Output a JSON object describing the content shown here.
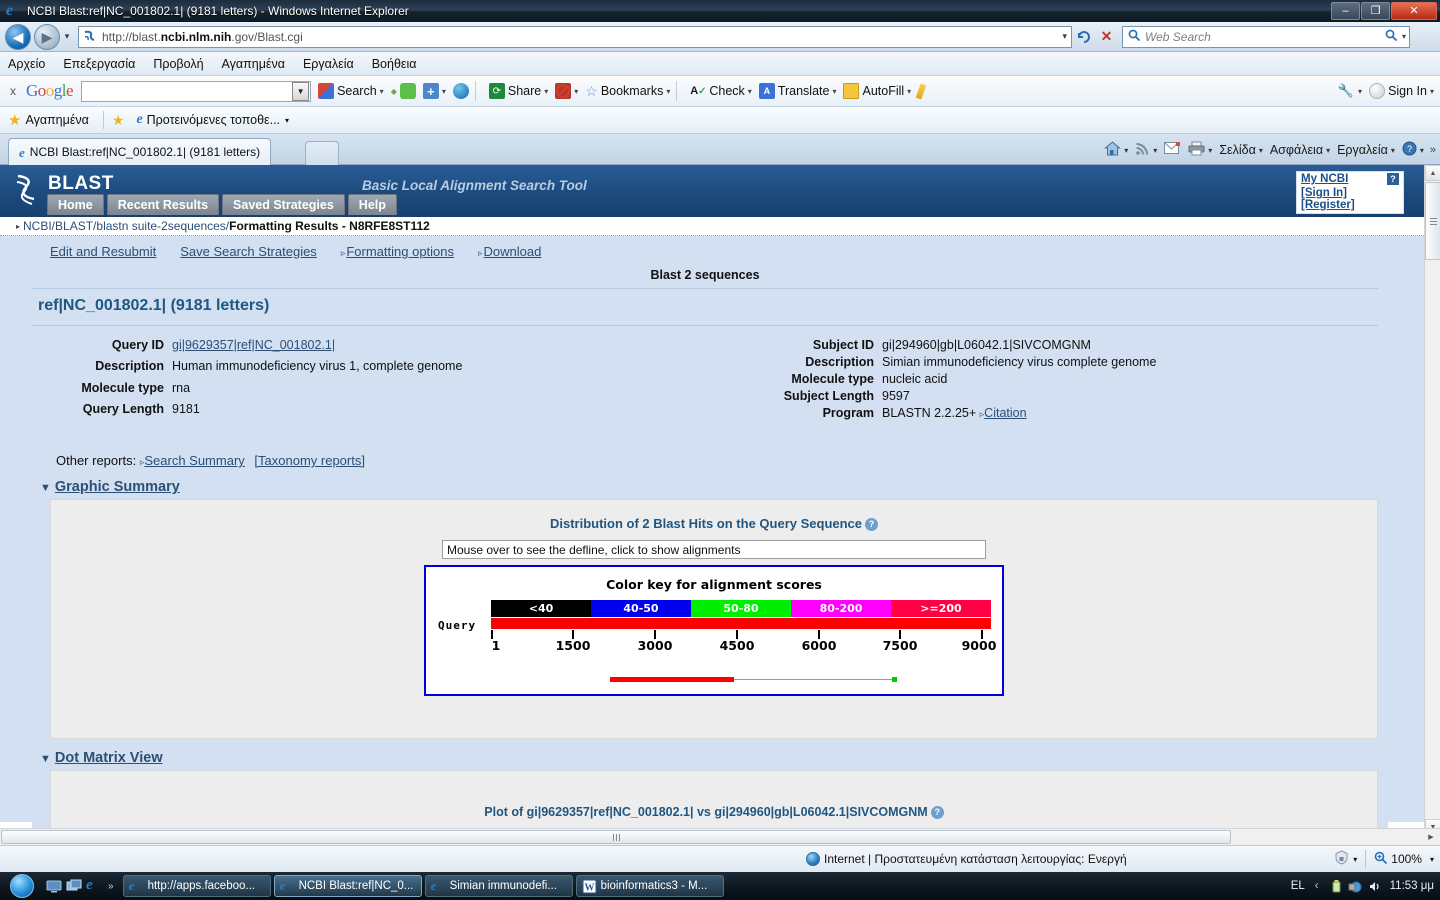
{
  "window": {
    "title": "NCBI Blast:ref|NC_001802.1| (9181 letters) - Windows Internet Explorer",
    "minimize_label": "–",
    "maximize_label": "❐",
    "close_label": "✕"
  },
  "address_bar": {
    "url_prefix": "http://blast.",
    "url_domain": "ncbi.nlm.nih",
    "url_suffix": ".gov/Blast.cgi",
    "dropdown_caret": "▾",
    "refresh_label": "↺",
    "stop_label": "✕",
    "search_placeholder": "Web Search",
    "search_icon": "⌕",
    "search_caret": "▾"
  },
  "menu_bar": {
    "items": [
      "Αρχείο",
      "Επεξεργασία",
      "Προβολή",
      "Αγαπημένα",
      "Εργαλεία",
      "Βοήθεια"
    ]
  },
  "google_toolbar": {
    "close_label": "x",
    "logo": [
      "G",
      "o",
      "o",
      "g",
      "l",
      "e"
    ],
    "search_value": "",
    "items": [
      {
        "label": "Search",
        "caret": "▾",
        "icon": "google-search-icon"
      },
      {
        "label": "",
        "caret": "",
        "icon": "sidewiki-icon"
      },
      {
        "label": "",
        "caret": "▾",
        "icon": "plus-icon"
      },
      {
        "label": "",
        "caret": "",
        "icon": "earth-icon"
      },
      {
        "label": "Share",
        "caret": "▾",
        "icon": "share-icon"
      },
      {
        "label": "",
        "caret": "▾",
        "icon": "popup-blocker-icon"
      },
      {
        "label": "Bookmarks",
        "caret": "▾",
        "icon": "star-icon"
      },
      {
        "label": "Check",
        "caret": "▾",
        "icon": "spellcheck-icon"
      },
      {
        "label": "Translate",
        "caret": "▾",
        "icon": "translate-icon"
      },
      {
        "label": "AutoFill",
        "caret": "▾",
        "icon": "autofill-icon"
      },
      {
        "label": "",
        "caret": "",
        "icon": "highlighter-icon"
      }
    ],
    "right": [
      {
        "label": "",
        "caret": "▾",
        "icon": "wrench-icon"
      },
      {
        "label": "Sign In",
        "caret": "▾",
        "icon": "user-icon"
      }
    ]
  },
  "favorites_bar": {
    "favorites_label": "Αγαπημένα",
    "suggested_label": "Προτεινόμενες τοποθε...",
    "suggested_caret": "▾"
  },
  "tab_bar": {
    "tab_title": "NCBI Blast:ref|NC_001802.1| (9181 letters)",
    "command_items": [
      {
        "label": "",
        "caret": "▾",
        "icon": "home-icon"
      },
      {
        "label": "",
        "caret": "▾",
        "icon": "rss-icon"
      },
      {
        "label": "",
        "caret": "",
        "icon": "mail-icon"
      },
      {
        "label": "",
        "caret": "▾",
        "icon": "print-icon"
      },
      {
        "label": "Σελίδα",
        "caret": "▾",
        "icon": "page-icon"
      },
      {
        "label": "Ασφάλεια",
        "caret": "▾",
        "icon": "security-icon"
      },
      {
        "label": "Εργαλεία",
        "caret": "▾",
        "icon": "tools-icon"
      },
      {
        "label": "",
        "caret": "▾",
        "icon": "help-icon"
      }
    ],
    "overflow": "»"
  },
  "blast": {
    "logo_text": "BLAST",
    "tagline": "Basic Local Alignment Search Tool",
    "nav_tabs": [
      "Home",
      "Recent Results",
      "Saved Strategies",
      "Help"
    ],
    "my_ncbi": {
      "title": "My NCBI",
      "help_badge": "?",
      "sign_in": "[Sign In]",
      "register": "[Register]"
    },
    "breadcrumb": {
      "arrow": "▸",
      "links": [
        "NCBI/",
        " BLAST/",
        " blastn suite-2sequences/"
      ],
      "current": " Formatting Results - N8RFE8ST112"
    },
    "toolbar_links": [
      {
        "label": "Edit and Resubmit",
        "triangle": ""
      },
      {
        "label": "Save Search Strategies",
        "triangle": ""
      },
      {
        "label": "Formatting options",
        "triangle": "▹"
      },
      {
        "label": "Download",
        "triangle": "▹"
      }
    ],
    "blast2seq_header": "Blast 2 sequences",
    "ref_heading": "ref|NC_001802.1| (9181 letters)",
    "query_info": [
      {
        "label": "Query ID",
        "value": "gi|9629357|ref|NC_001802.1|",
        "link": true
      },
      {
        "label": "Description",
        "value": "Human immunodeficiency virus 1, complete genome",
        "link": false
      },
      {
        "label": "Molecule type",
        "value": "rna",
        "link": false
      },
      {
        "label": "Query Length",
        "value": "9181",
        "link": false
      }
    ],
    "subject_info": [
      {
        "label": "Subject ID",
        "value": "gi|294960|gb|L06042.1|SIVCOMGNM",
        "link": false
      },
      {
        "label": "Description",
        "value": "Simian immunodeficiency virus complete genome",
        "link": false
      },
      {
        "label": "Molecule type",
        "value": "nucleic acid",
        "link": false
      },
      {
        "label": "Subject Length",
        "value": "9597",
        "link": false
      },
      {
        "label": "Program",
        "value": "BLASTN 2.2.25+",
        "link": false,
        "extra_link": "Citation",
        "extra_triangle": "▹"
      }
    ],
    "other_reports": {
      "label": "Other reports:",
      "triangle": "▹",
      "search_summary": "Search Summary",
      "taxonomy_reports": "[Taxonomy reports]"
    },
    "graphic_summary": {
      "caret": "▼",
      "heading": "Graphic Summary",
      "distribution_title": "Distribution of 2 Blast Hits on the Query Sequence",
      "help_badge": "?",
      "mouseover_hint": "Mouse over to see the defline, click to show alignments"
    },
    "dot_matrix": {
      "caret": "▼",
      "heading": "Dot Matrix View",
      "plot_title": "Plot of gi|9629357|ref|NC_001802.1| vs gi|294960|gb|L06042.1|SIVCOMGNM",
      "help_badge": "?"
    }
  },
  "chart_data": {
    "type": "bar",
    "title": "Color key for alignment scores",
    "subtitle": "Distribution of 2 Blast Hits on the Query Sequence",
    "xlabel": "",
    "ylabel": "Query",
    "color_key": [
      {
        "label": "<40",
        "color": "#000000"
      },
      {
        "label": "40-50",
        "color": "#0000ee"
      },
      {
        "label": "50-80",
        "color": "#00ee00"
      },
      {
        "label": "80-200",
        "color": "#ff00ff"
      },
      {
        "label": ">=200",
        "color": "#ff0044"
      }
    ],
    "query_track": {
      "label": "Query",
      "color": "#ff0000",
      "start": 1,
      "end": 9181
    },
    "axis_ticks": [
      1,
      1500,
      3000,
      4500,
      6000,
      7500,
      9000
    ],
    "axis_range": [
      1,
      9181
    ],
    "hits": [
      {
        "id": "hit-1",
        "color": "#ff0000",
        "score_band": ">=200",
        "query_start": 2100,
        "query_end": 4200
      },
      {
        "id": "hit-2",
        "color": "#00cc00",
        "score_band": "50-80",
        "query_start": 7400,
        "query_end": 7500
      }
    ],
    "connector": {
      "color": "#999999",
      "from": 4200,
      "to": 7400
    }
  },
  "status_bar": {
    "zone_text": "Internet | Προστατευμένη κατάσταση λειτουργίας: Ενεργή",
    "zoom_level": "100%",
    "zone_caret": "▾",
    "zoom_caret": "▾"
  },
  "taskbar": {
    "overflow": "»",
    "items": [
      {
        "label": "http://apps.faceboo...",
        "icon": "ie-icon",
        "active": false
      },
      {
        "label": "NCBI Blast:ref|NC_0...",
        "icon": "ie-icon",
        "active": true
      },
      {
        "label": "Simian immunodefi...",
        "icon": "ie-icon",
        "active": false
      },
      {
        "label": "bioinformatics3 - M...",
        "icon": "word-icon",
        "active": false
      }
    ],
    "tray": {
      "language": "EL",
      "chevron": "‹",
      "clock": "11:53 μμ"
    }
  }
}
